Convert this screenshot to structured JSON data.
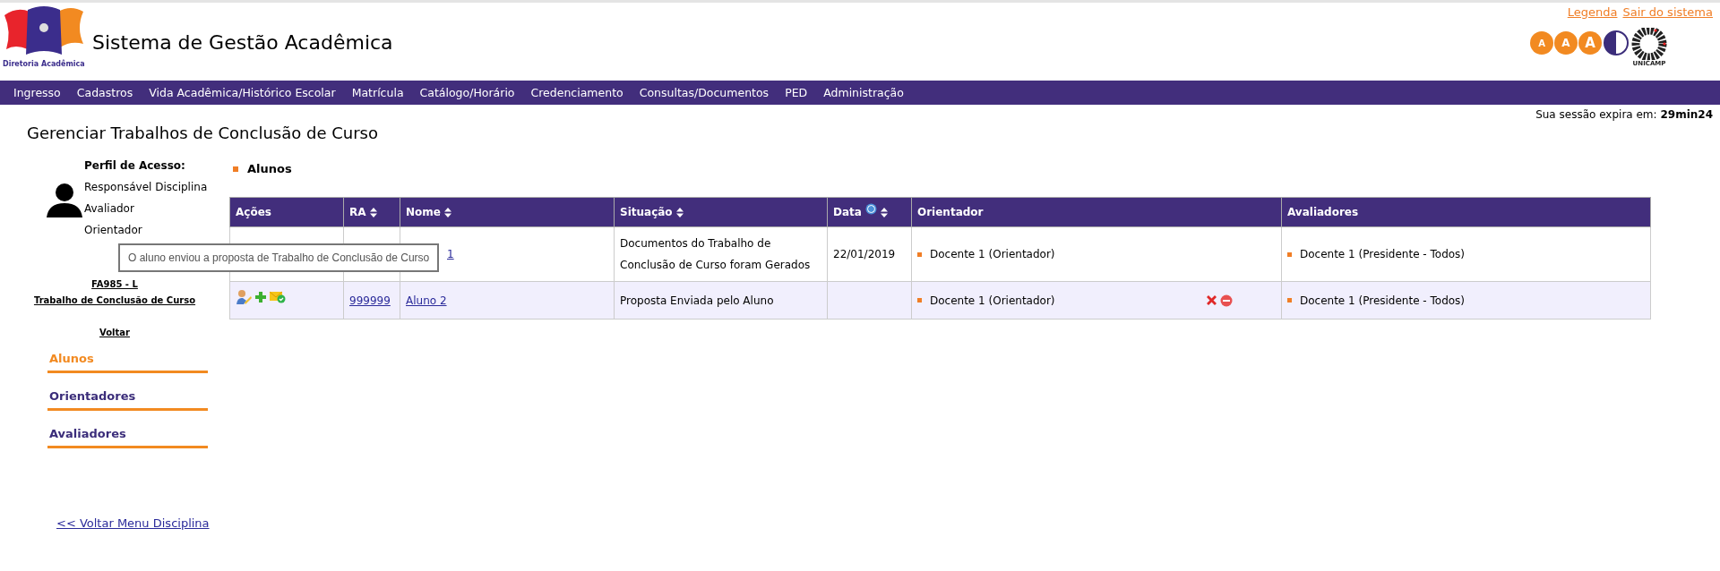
{
  "header": {
    "logo_caption": "Diretoria Acadêmica",
    "title": "Sistema de Gestão Acadêmica",
    "links": [
      "Legenda",
      "Sair do sistema"
    ],
    "font_size_buttons": [
      "A",
      "A",
      "A"
    ],
    "unicamp_caption": "UNICAMP"
  },
  "nav": [
    "Ingresso",
    "Cadastros",
    "Vida Acadêmica/Histórico Escolar",
    "Matrícula",
    "Catálogo/Horário",
    "Credenciamento",
    "Consultas/Documentos",
    "PED",
    "Administração"
  ],
  "session": {
    "label": "Sua sessão expira em:",
    "value": "29min24"
  },
  "page_title": "Gerenciar Trabalhos de Conclusão de Curso",
  "profile": {
    "heading": "Perfil de Acesso:",
    "roles": [
      "Responsável Disciplina",
      "Avaliador",
      "Orientador"
    ]
  },
  "course": {
    "code": "FA985 - L",
    "name": "Trabalho de Conclusão de Curso",
    "back": "Voltar"
  },
  "side_menu": [
    {
      "label": "Alunos",
      "selected": true
    },
    {
      "label": "Orientadores",
      "selected": false
    },
    {
      "label": "Avaliadores",
      "selected": false
    }
  ],
  "section_title": "Alunos",
  "table": {
    "columns": [
      {
        "label": "Ações",
        "sortable": false,
        "help": false
      },
      {
        "label": "RA",
        "sortable": true,
        "help": false
      },
      {
        "label": "Nome",
        "sortable": true,
        "help": false
      },
      {
        "label": "Situação",
        "sortable": true,
        "help": false
      },
      {
        "label": "Data",
        "sortable": true,
        "help": true
      },
      {
        "label": "Orientador",
        "sortable": false,
        "help": false
      },
      {
        "label": "Avaliadores",
        "sortable": false,
        "help": false
      }
    ],
    "rows": [
      {
        "partly_hidden": true,
        "actions": false,
        "ra": "",
        "nome": "1",
        "situacao": "Documentos do Trabalho de Conclusão de Curso foram Gerados",
        "data": "22/01/2019",
        "orientador": "Docente 1 (Orientador)",
        "orientador_actions": false,
        "avaliadores": "Docente 1 (Presidente - Todos)"
      },
      {
        "partly_hidden": false,
        "actions": true,
        "ra": "999999",
        "nome": "Aluno 2",
        "situacao": "Proposta Enviada pelo Aluno",
        "data": "",
        "orientador": "Docente 1 (Orientador)",
        "orientador_actions": true,
        "avaliadores": "Docente 1 (Presidente - Todos)"
      }
    ]
  },
  "tooltip": "O aluno enviou a proposta de Trabalho de Conclusão de Curso",
  "footer_link": "<< Voltar Menu Disciplina"
}
